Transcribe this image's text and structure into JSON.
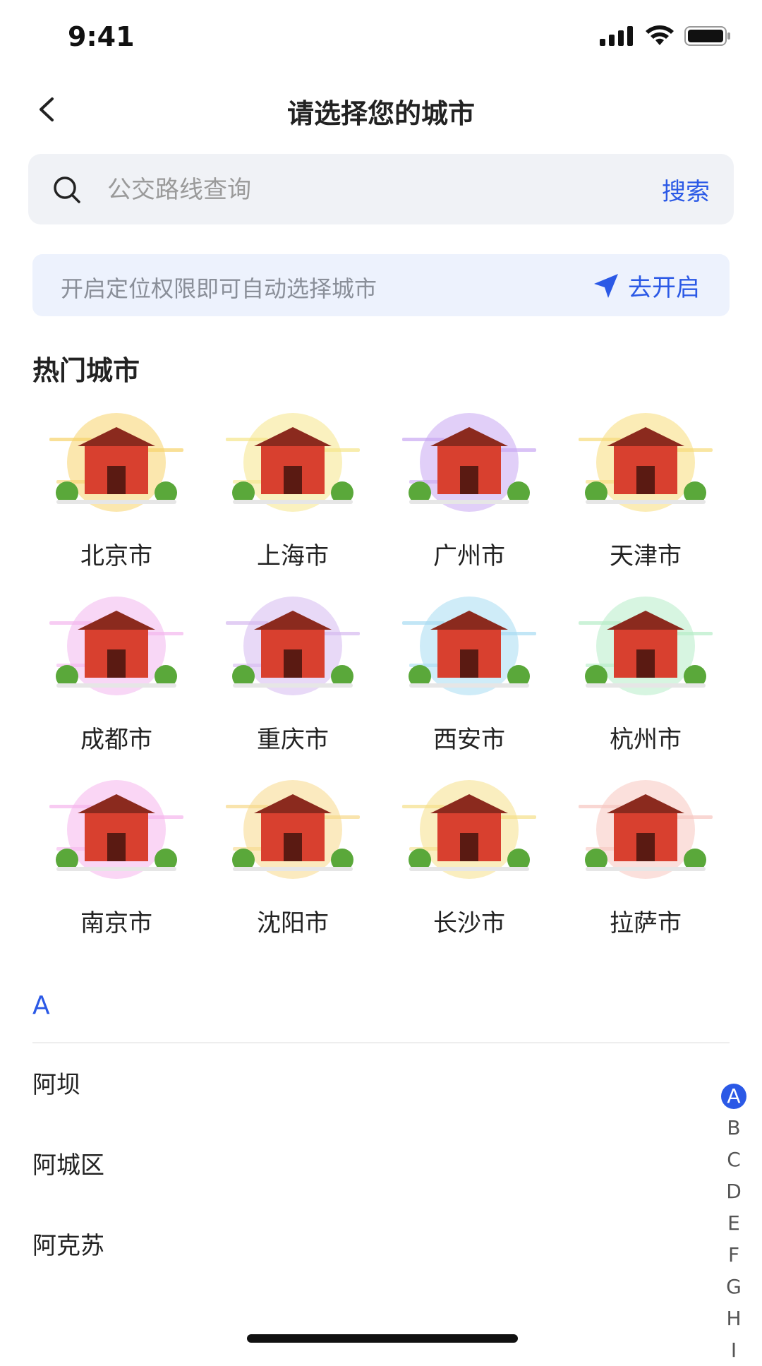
{
  "status": {
    "time": "9:41"
  },
  "nav": {
    "title": "请选择您的城市"
  },
  "search": {
    "placeholder": "公交路线查询",
    "button": "搜索"
  },
  "location": {
    "text": "开启定位权限即可自动选择城市",
    "action": "去开启"
  },
  "hot": {
    "title": "热门城市",
    "cities": [
      {
        "name": "北京市",
        "icon": "forbidden-city-icon",
        "glow": "#f7d36b"
      },
      {
        "name": "上海市",
        "icon": "oriental-pearl-tower-icon",
        "glow": "#f5e68a"
      },
      {
        "name": "广州市",
        "icon": "canton-tower-icon",
        "glow": "#c9a8f2"
      },
      {
        "name": "天津市",
        "icon": "tianjin-eye-icon",
        "glow": "#f7dc7a"
      },
      {
        "name": "成都市",
        "icon": "bell-tower-icon",
        "glow": "#f3b6ee"
      },
      {
        "name": "重庆市",
        "icon": "twin-towers-icon",
        "glow": "#d6b9f0"
      },
      {
        "name": "西安市",
        "icon": "big-wild-goose-pagoda-icon",
        "glow": "#a8dcf2"
      },
      {
        "name": "杭州市",
        "icon": "west-lake-icon",
        "glow": "#b6edc8"
      },
      {
        "name": "南京市",
        "icon": "nanjing-gate-icon",
        "glow": "#f5b5ec"
      },
      {
        "name": "沈阳市",
        "icon": "shenyang-palace-icon",
        "glow": "#f7d88a"
      },
      {
        "name": "长沙市",
        "icon": "yuelu-academy-icon",
        "glow": "#f5e08a"
      },
      {
        "name": "拉萨市",
        "icon": "potala-palace-icon",
        "glow": "#f7c6c0"
      }
    ]
  },
  "list": {
    "section": "A",
    "items": [
      {
        "name": "阿坝"
      },
      {
        "name": "阿城区"
      },
      {
        "name": "阿克苏"
      }
    ]
  },
  "index": {
    "letters": [
      "A",
      "B",
      "C",
      "D",
      "E",
      "F",
      "G",
      "H",
      "I"
    ],
    "active": "A"
  },
  "colors": {
    "accent": "#2b59e6",
    "search_bg": "#f0f2f6",
    "banner_bg": "#edf2fd"
  }
}
